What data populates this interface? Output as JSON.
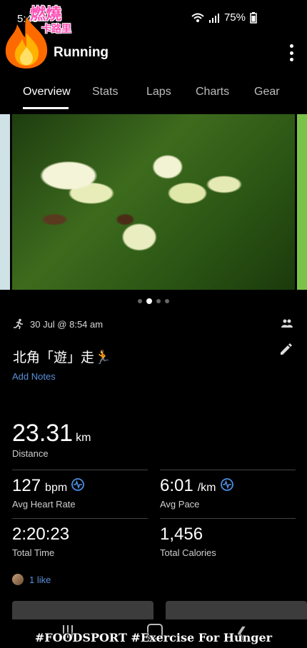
{
  "status_bar": {
    "time": "5:43",
    "battery": "75%",
    "icons": [
      "sim-icon",
      "wifi-icon",
      "volte-icon",
      "signal-icon",
      "battery-icon"
    ]
  },
  "logo": {
    "line1": "燃燒",
    "line2": "卡路里"
  },
  "app_bar": {
    "title": "Running"
  },
  "tabs": [
    {
      "label": "Overview",
      "active": true
    },
    {
      "label": "Stats",
      "active": false
    },
    {
      "label": "Laps",
      "active": false
    },
    {
      "label": "Charts",
      "active": false
    },
    {
      "label": "Gear",
      "active": false
    }
  ],
  "carousel": {
    "pages": 4,
    "active_page": 2
  },
  "activity": {
    "datetime": "30 Jul @ 8:54 am",
    "title": "北角「遊」走🏃",
    "add_notes": "Add Notes"
  },
  "stats": {
    "distance": {
      "value": "23.31",
      "unit": "km",
      "label": "Distance"
    },
    "heart_rate": {
      "value": "127",
      "unit": "bpm",
      "label": "Avg Heart Rate"
    },
    "pace": {
      "value": "6:01",
      "unit": "/km",
      "label": "Avg Pace"
    },
    "time": {
      "value": "2:20:23",
      "label": "Total Time"
    },
    "calories": {
      "value": "1,456",
      "label": "Total Calories"
    }
  },
  "social": {
    "likes": "1 like"
  },
  "watermark": "#FOODSPORT #Exercise For Hunger",
  "colors": {
    "accent": "#5a8fd8",
    "background": "#000000",
    "badge_pink": "#ff4fb5"
  }
}
